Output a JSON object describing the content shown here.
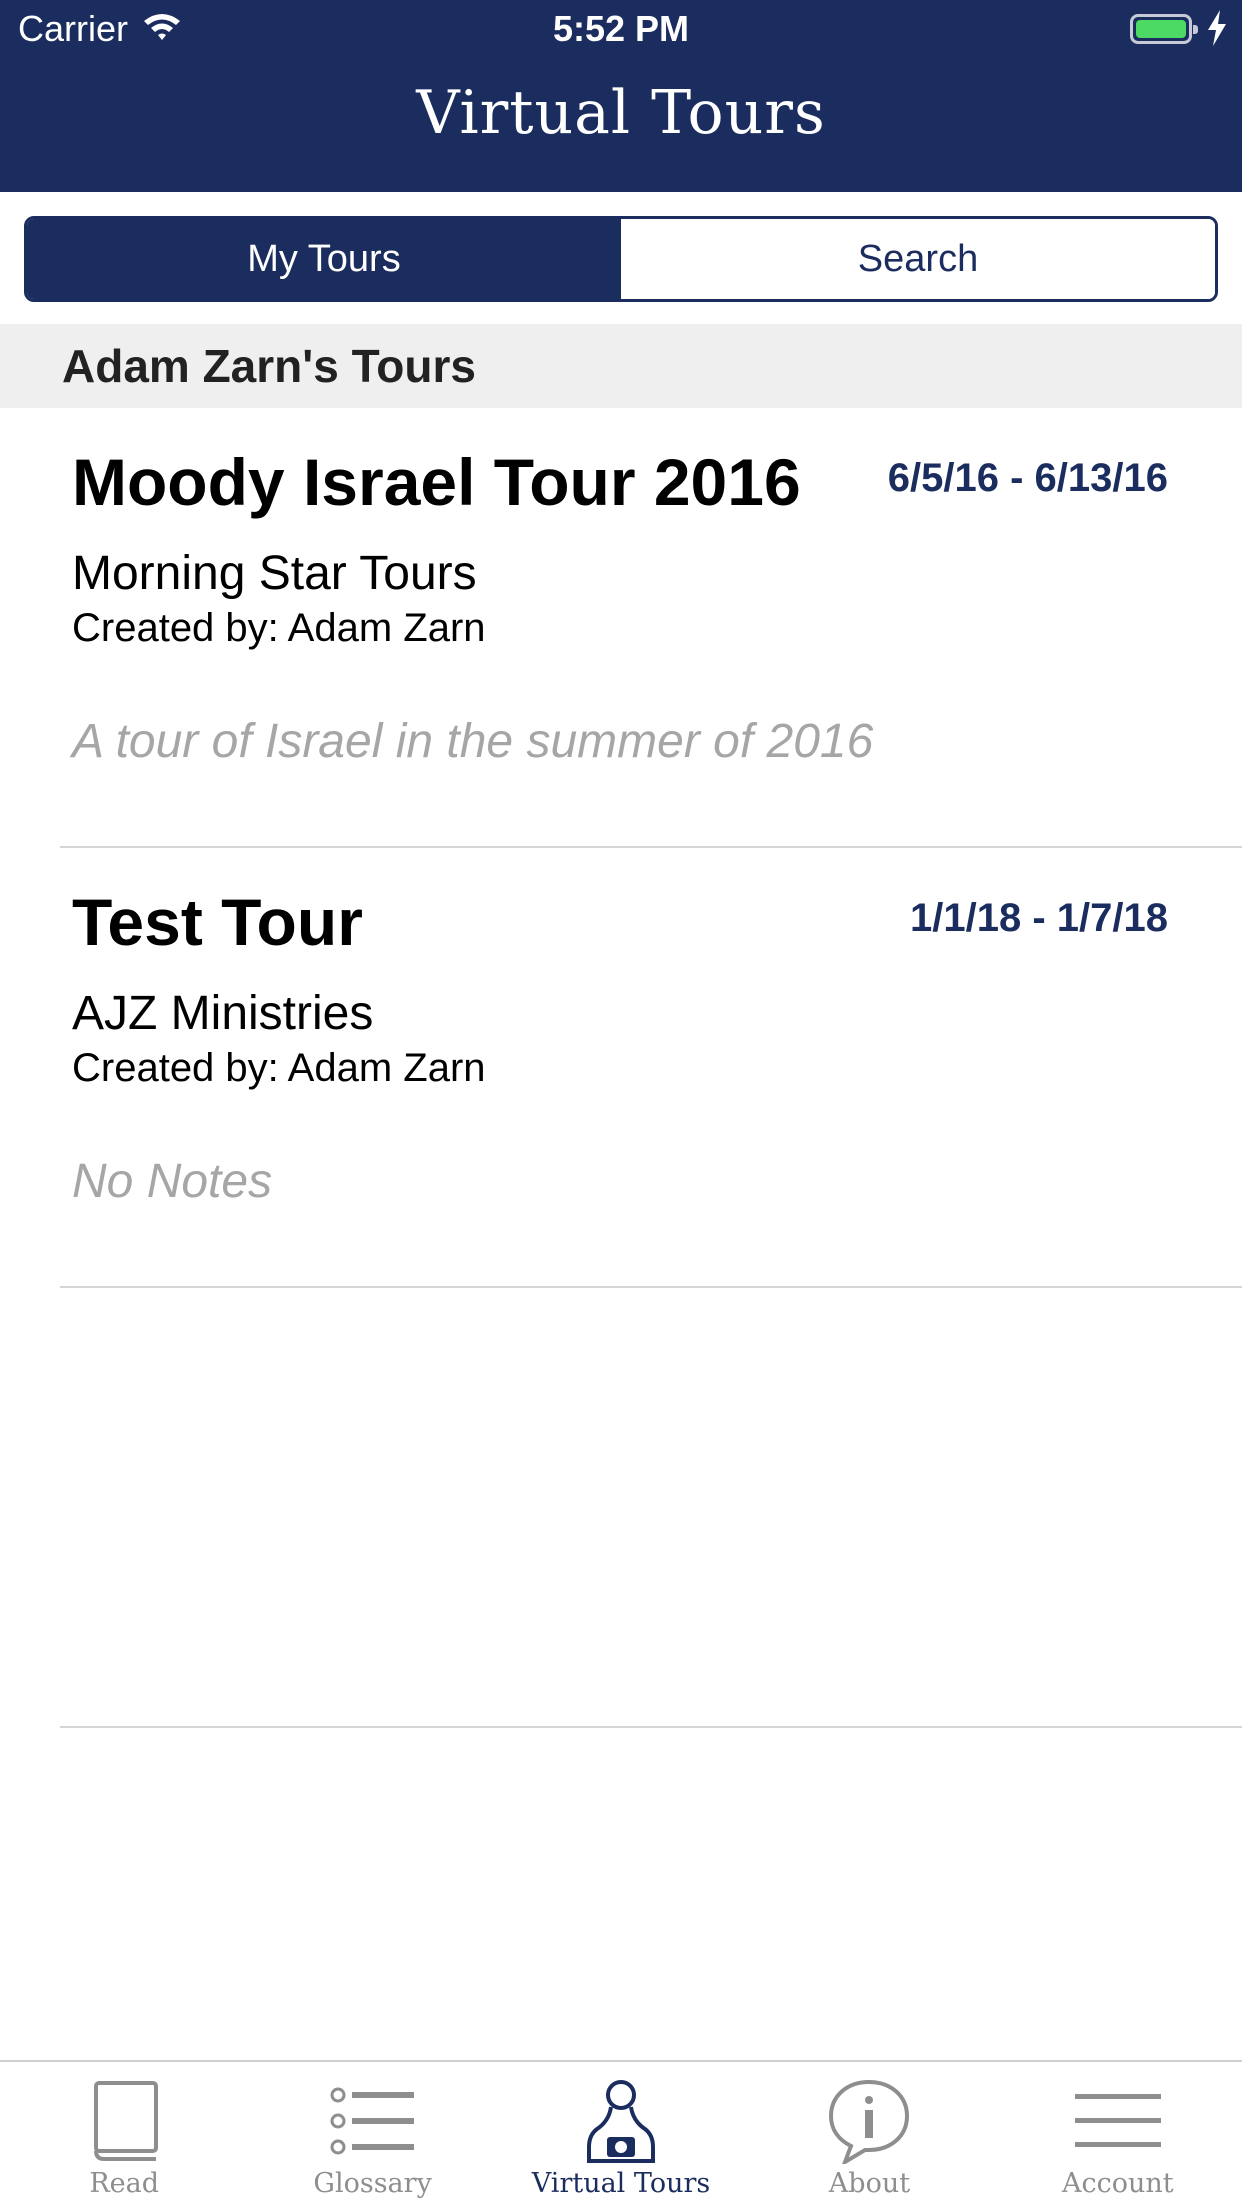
{
  "status_bar": {
    "carrier": "Carrier",
    "time": "5:52 PM"
  },
  "nav": {
    "title": "Virtual Tours"
  },
  "segments": {
    "left": "My Tours",
    "right": "Search",
    "selected": "My Tours"
  },
  "section": {
    "title": "Adam Zarn's Tours"
  },
  "tours": [
    {
      "name": "Moody Israel Tour 2016",
      "dates": "6/5/16 - 6/13/16",
      "organization": "Morning Star Tours",
      "created_by": "Created by: Adam Zarn",
      "notes": "A tour of Israel in the summer of 2016"
    },
    {
      "name": "Test Tour",
      "dates": "1/1/18 - 1/7/18",
      "organization": "AJZ Ministries",
      "created_by": "Created by: Adam Zarn",
      "notes": "No Notes"
    }
  ],
  "tabbar": {
    "items": [
      {
        "label": "Read",
        "icon": "book-icon"
      },
      {
        "label": "Glossary",
        "icon": "list-icon"
      },
      {
        "label": "Virtual Tours",
        "icon": "tourist-camera-icon"
      },
      {
        "label": "About",
        "icon": "info-bubble-icon"
      },
      {
        "label": "Account",
        "icon": "menu-icon"
      }
    ],
    "active": "Virtual Tours"
  },
  "colors": {
    "brand_navy": "#1b2d5e",
    "battery_green": "#4cd964",
    "inactive_gray": "#8e8e8e"
  }
}
